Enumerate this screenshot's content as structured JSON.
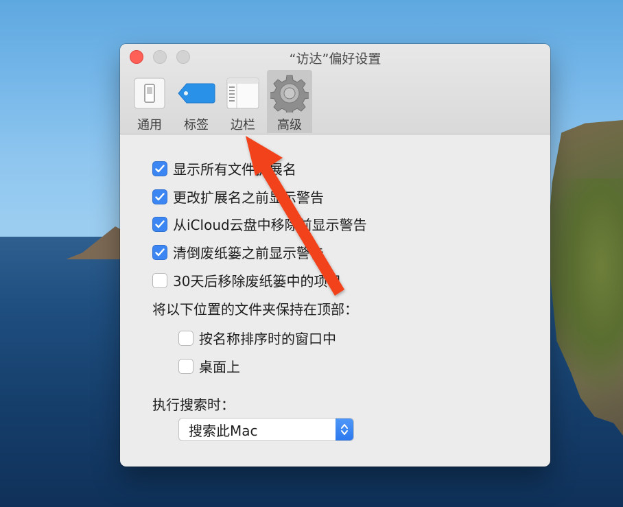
{
  "window": {
    "title": "“访达”偏好设置"
  },
  "toolbar": {
    "tabs": [
      {
        "label": "通用",
        "icon": "switch-icon"
      },
      {
        "label": "标签",
        "icon": "tag-icon"
      },
      {
        "label": "边栏",
        "icon": "sidebar-icon"
      },
      {
        "label": "高级",
        "icon": "gear-icon"
      }
    ],
    "active_tab": "高级"
  },
  "options": [
    {
      "label": "显示所有文件扩展名",
      "checked": true
    },
    {
      "label": "更改扩展名之前显示警告",
      "checked": true
    },
    {
      "label": "从iCloud云盘中移除前显示警告",
      "checked": true
    },
    {
      "label": "清倒废纸篓之前显示警告",
      "checked": true
    },
    {
      "label": "30天后移除废纸篓中的项目",
      "checked": false
    }
  ],
  "folders_on_top": {
    "heading": "将以下位置的文件夹保持在顶部：",
    "items": [
      {
        "label": "按名称排序时的窗口中",
        "checked": false
      },
      {
        "label": "桌面上",
        "checked": false
      }
    ]
  },
  "search": {
    "heading": "执行搜索时：",
    "selected": "搜索此Mac"
  },
  "colors": {
    "accent": "#3b86f2",
    "annotation_arrow": "#f2431c"
  }
}
